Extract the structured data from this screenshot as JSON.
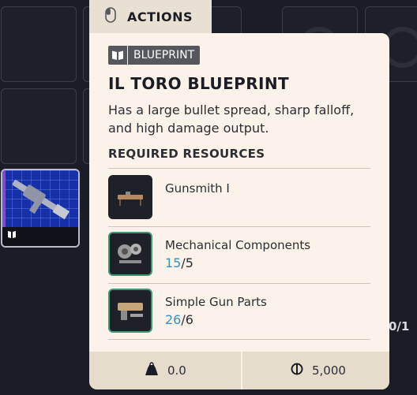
{
  "actions_tab": {
    "label": "ACTIONS",
    "icon": "mouse-icon"
  },
  "item": {
    "tag": "BLUEPRINT",
    "tag_icon": "book-icon",
    "title": "IL TORO BLUEPRINT",
    "description": "Has a large bullet spread, sharp falloff, and high damage output."
  },
  "required": {
    "header": "REQUIRED RESOURCES",
    "items": [
      {
        "name": "Gunsmith I",
        "icon": "workbench-icon"
      },
      {
        "name": "Mechanical Components",
        "have": "15",
        "sep": "/",
        "need": "5",
        "icon": "mechanical-components-icon"
      },
      {
        "name": "Simple Gun Parts",
        "have": "26",
        "sep": "/",
        "need": "6",
        "icon": "gun-parts-icon"
      }
    ]
  },
  "footer": {
    "weight": "0.0",
    "weight_icon": "weight-icon",
    "price": "5,000",
    "price_icon": "coin-icon"
  },
  "background": {
    "side_text": "0/1"
  },
  "colors": {
    "panel": "#fbf3e9",
    "have_qty": "#3a8fc3",
    "accent_border": "#3f9a73"
  }
}
